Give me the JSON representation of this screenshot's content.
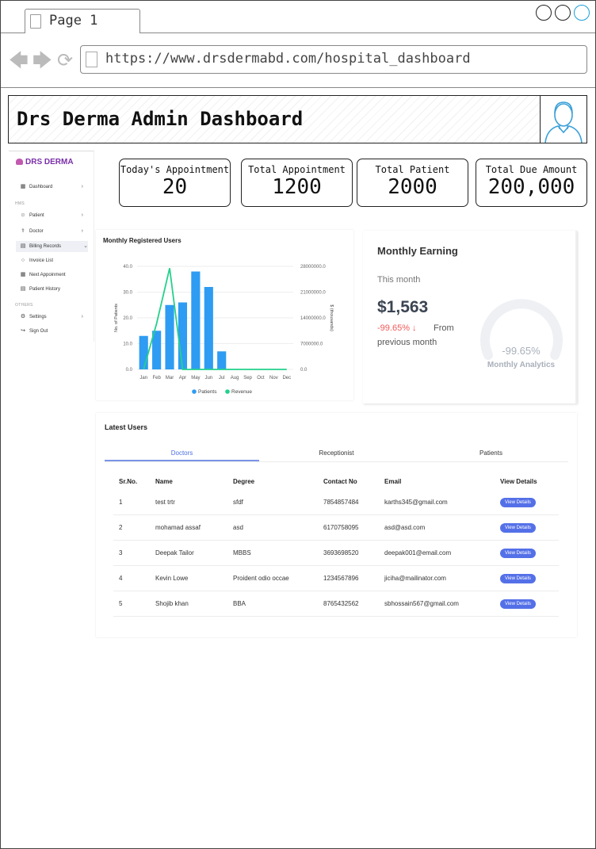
{
  "browser": {
    "tab_label": "Page 1",
    "url": "https://www.drsdermabd.com/hospital_dashboard"
  },
  "header": {
    "title": "Drs Derma Admin Dashboard"
  },
  "sidebar": {
    "brand": "DRS DERMA",
    "items": [
      {
        "label": "Dashboard",
        "icon": "grid-icon",
        "chevron": "›"
      },
      {
        "section": "HMS"
      },
      {
        "label": "Patient",
        "icon": "user-icon",
        "chevron": "›"
      },
      {
        "label": "Doctor",
        "icon": "stethoscope-icon",
        "chevron": "›"
      },
      {
        "label": "Billing Records",
        "icon": "receipt-icon",
        "chevron": "⌄",
        "active": true
      },
      {
        "label": "Invoice List",
        "icon": "dot-icon",
        "sub": true
      },
      {
        "label": "Next Appoinment",
        "icon": "calendar-icon"
      },
      {
        "label": "Patient History",
        "icon": "history-icon"
      },
      {
        "section": "OTHERS"
      },
      {
        "label": "Settings",
        "icon": "gear-icon",
        "chevron": "›"
      },
      {
        "label": "Sign Out",
        "icon": "logout-icon"
      }
    ]
  },
  "stats": [
    {
      "label": "Today's Appointment",
      "value": "20"
    },
    {
      "label": "Total Appointment",
      "value": "1200"
    },
    {
      "label": "Total Patient",
      "value": "2000"
    },
    {
      "label": "Total Due Amount",
      "value": "200,000"
    }
  ],
  "chart_data": {
    "type": "bar",
    "title": "Monthly Registered Users",
    "categories": [
      "Jan",
      "Feb",
      "Mar",
      "Apr",
      "May",
      "Jun",
      "Jul",
      "Aug",
      "Sep",
      "Oct",
      "Nov",
      "Dec"
    ],
    "ylabel": "No. of Patients",
    "y2label": "$ (thousands)",
    "ylim": [
      0,
      40
    ],
    "y2lim": [
      0,
      28000000
    ],
    "yticks": [
      "0.0",
      "10.0",
      "20.0",
      "30.0",
      "40.0"
    ],
    "y2ticks": [
      "0.0",
      "7000000.0",
      "14000000.0",
      "21000000.0",
      "28000000.0"
    ],
    "series": [
      {
        "name": "Patients",
        "type": "bar",
        "axis": "left",
        "color": "#2e9cf2",
        "values": [
          13,
          15,
          25,
          26,
          38,
          32,
          7,
          0,
          0,
          0,
          0,
          0
        ]
      },
      {
        "name": "Revenue",
        "type": "line",
        "axis": "right",
        "color": "#23d18b",
        "values": [
          0,
          12500000,
          27500000,
          0,
          0,
          0,
          0,
          0,
          0,
          0,
          0,
          0
        ]
      }
    ],
    "legend": "bottom"
  },
  "earning": {
    "title": "Monthly Earning",
    "period": "This month",
    "amount": "$1,563",
    "change": "-99.65%",
    "change_arrow": "↓",
    "from": "From",
    "previous": "previous month",
    "gauge_value": "-99.65%",
    "gauge_label": "Monthly Analytics"
  },
  "latest_users": {
    "title": "Latest Users",
    "tabs": [
      "Doctors",
      "Receptionist",
      "Patients"
    ],
    "active_tab": 0,
    "columns": [
      "Sr.No.",
      "Name",
      "Degree",
      "Contact No",
      "Email",
      "View Details"
    ],
    "button_label": "View Details",
    "rows": [
      {
        "no": "1",
        "name": "test trtr",
        "degree": "sfdf",
        "contact": "7854857484",
        "email": "karths345@gmail.com"
      },
      {
        "no": "2",
        "name": "mohamad assaf",
        "degree": "asd",
        "contact": "6170758095",
        "email": "asd@asd.com"
      },
      {
        "no": "3",
        "name": "Deepak Tailor",
        "degree": "MBBS",
        "contact": "3693698520",
        "email": "deepak001@email.com"
      },
      {
        "no": "4",
        "name": "Kevin Lowe",
        "degree": "Proident odio occae",
        "contact": "1234567896",
        "email": "jiciha@mailinator.com"
      },
      {
        "no": "5",
        "name": "Shojib khan",
        "degree": "BBA",
        "contact": "8765432562",
        "email": "sbhossain567@gmail.com"
      }
    ]
  }
}
